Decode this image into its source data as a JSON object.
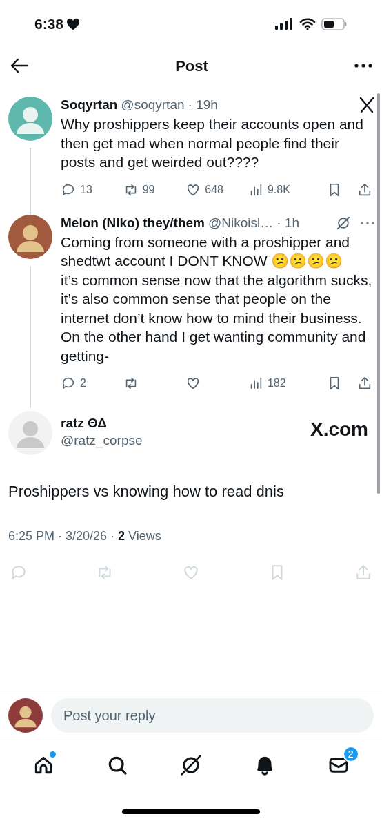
{
  "status_bar": {
    "time": "6:38"
  },
  "header": {
    "title": "Post"
  },
  "thread": [
    {
      "name": "Soqyrtan",
      "handle": "@soqyrtan",
      "time": "· 19h",
      "kind": "x",
      "text": "Why proshippers keep their accounts open and then get mad when normal people find their posts and get weirded out????",
      "actions": [
        {
          "kind": "reply",
          "count": "13"
        },
        {
          "kind": "repost",
          "count": "99"
        },
        {
          "kind": "like",
          "count": "648"
        },
        {
          "kind": "views",
          "count": "9.8K"
        }
      ]
    },
    {
      "name": "Melon (Niko) they/them",
      "handle": "@Nikoisl…",
      "time": "· 1h",
      "kind": "grok",
      "text": "Coming from someone with a proshipper and shedtwt account I DONT KNOW 😕😕😕😕\nit’s common sense now that the algorithm sucks, it’s also common sense that people on the internet don’t know how to mind their business.\nOn the other hand I get wanting community and getting-",
      "actions": [
        {
          "kind": "reply",
          "count": "2"
        },
        {
          "kind": "repost"
        },
        {
          "kind": "like"
        },
        {
          "kind": "views",
          "count": "182"
        }
      ]
    }
  ],
  "main_post": {
    "name": "ratz ΘΔ",
    "handle": "@ratz_corpse",
    "source": "X.com",
    "text": "Proshippers vs knowing how to read dnis",
    "time": "6:25 PM",
    "date": "· 3/20/26 ·",
    "views_count": "2",
    "views_label": "Views",
    "actions_disabled": true,
    "actions": [
      {
        "kind": "reply"
      },
      {
        "kind": "repost"
      },
      {
        "kind": "like"
      },
      {
        "kind": "bookmark"
      },
      {
        "kind": "share"
      }
    ]
  },
  "reply_bar": {
    "placeholder": "Post your reply"
  },
  "nav": [
    {
      "kind": "home",
      "selected": false,
      "dot": true
    },
    {
      "kind": "search",
      "selected": false
    },
    {
      "kind": "grok",
      "selected": false
    },
    {
      "kind": "notifications",
      "selected": true
    },
    {
      "kind": "messages",
      "selected": false,
      "badge": "2"
    }
  ]
}
